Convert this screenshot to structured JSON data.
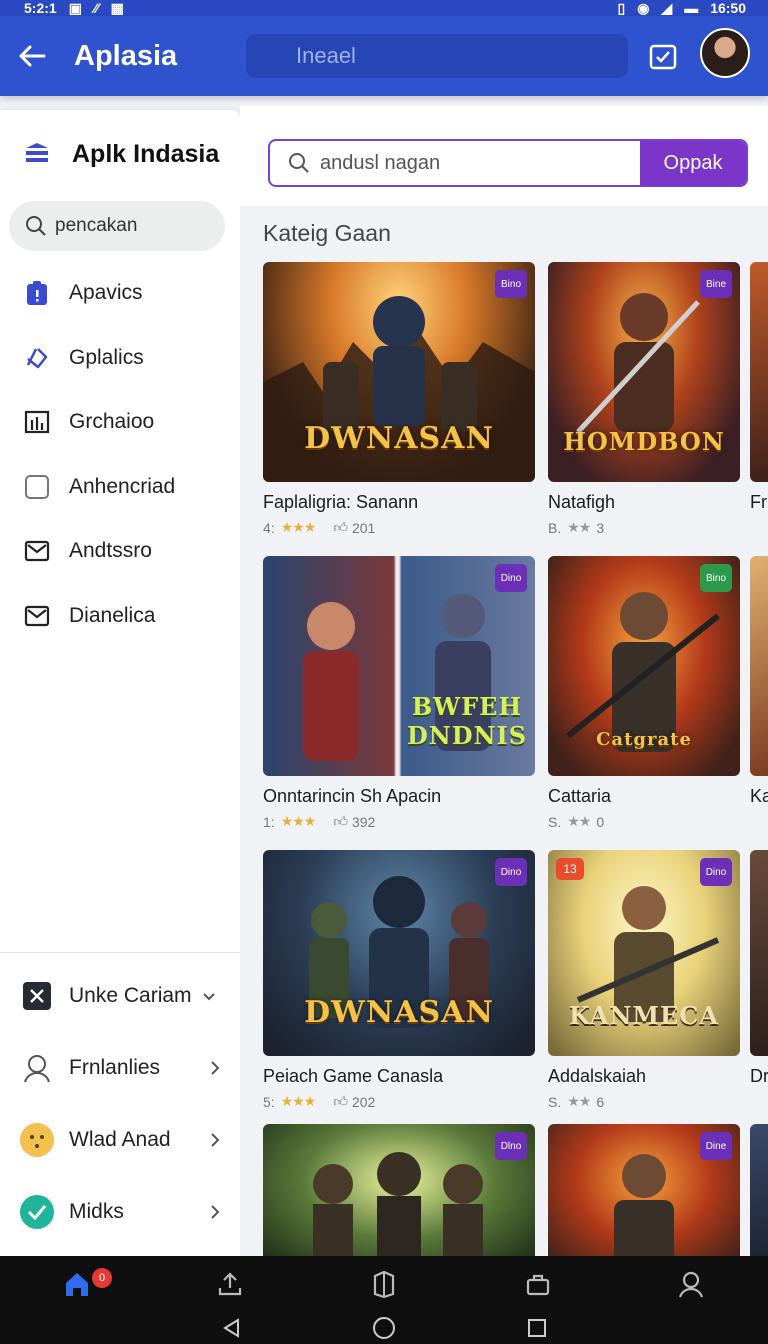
{
  "status_bar": {
    "time_left": "5:2:1",
    "time_right": "16:50"
  },
  "app_bar": {
    "title": "Aplasia",
    "search_placeholder": "Ineael"
  },
  "sidebar": {
    "app_name": "Aplk Indasia",
    "search_value": "pencakan",
    "items": [
      {
        "label": "Apavics",
        "icon": "clipboard-alert-icon",
        "color": "#3b4bd1"
      },
      {
        "label": "Gplalics",
        "icon": "puzzle-icon",
        "color": "#3b4bd1"
      },
      {
        "label": "Grchaioo",
        "icon": "chart-icon",
        "color": "#222222"
      },
      {
        "label": "Anhencriad",
        "icon": "square-icon",
        "color": "#888888"
      },
      {
        "label": "Andtssro",
        "icon": "mail-icon",
        "color": "#222222"
      },
      {
        "label": "Dianelica",
        "icon": "mail-icon",
        "color": "#222222"
      }
    ],
    "bottom_items": [
      {
        "label": "Unke Cariam",
        "icon": "tools-icon",
        "chevron": "down"
      },
      {
        "label": "Frnlanlies",
        "icon": "user-icon",
        "chevron": "right"
      },
      {
        "label": "Wlad Anad",
        "icon": "emoji-icon",
        "chevron": "right"
      },
      {
        "label": "Midks",
        "icon": "check-circle-icon",
        "chevron": "right"
      }
    ]
  },
  "main": {
    "search_value": "andusl nagan",
    "search_button": "Oppak",
    "category_title": "Kateig Gaan",
    "games": [
      {
        "title": "Faplaligria: Sanann",
        "rating": "4:",
        "stars": "★★★",
        "downloads": "201",
        "badge": "Bino",
        "logo": "DWNASAN"
      },
      {
        "title": "Natafigh",
        "rating": "B.",
        "stars": "★★",
        "downloads": "3",
        "badge": "Bine",
        "logo": "HOMDBON"
      },
      {
        "title": "Onntarincin Sh Apacin",
        "rating": "1:",
        "stars": "★★★",
        "downloads": "392",
        "badge": "Dino",
        "logo": "BWFEH DNDNIS"
      },
      {
        "title": "Cattaria",
        "rating": "S.",
        "stars": "★★",
        "downloads": "0",
        "badge": "Bino",
        "logo": "Catgrate"
      },
      {
        "title": "Peiach Game Canasla",
        "rating": "5:",
        "stars": "★★★",
        "downloads": "202",
        "badge": "Dino",
        "logo": "DWNASAN"
      },
      {
        "title": "Addalskaiah",
        "rating": "S.",
        "stars": "★★",
        "downloads": "6",
        "badge": "Dino",
        "rank": "13",
        "logo": "KANMECA"
      },
      {
        "title": "",
        "badge": "Dlno"
      },
      {
        "title": "",
        "badge": "Dine"
      }
    ],
    "partial_titles": [
      "Fr",
      "Ka",
      "Dr"
    ]
  },
  "bottom_nav": {
    "notification_count": "0"
  }
}
